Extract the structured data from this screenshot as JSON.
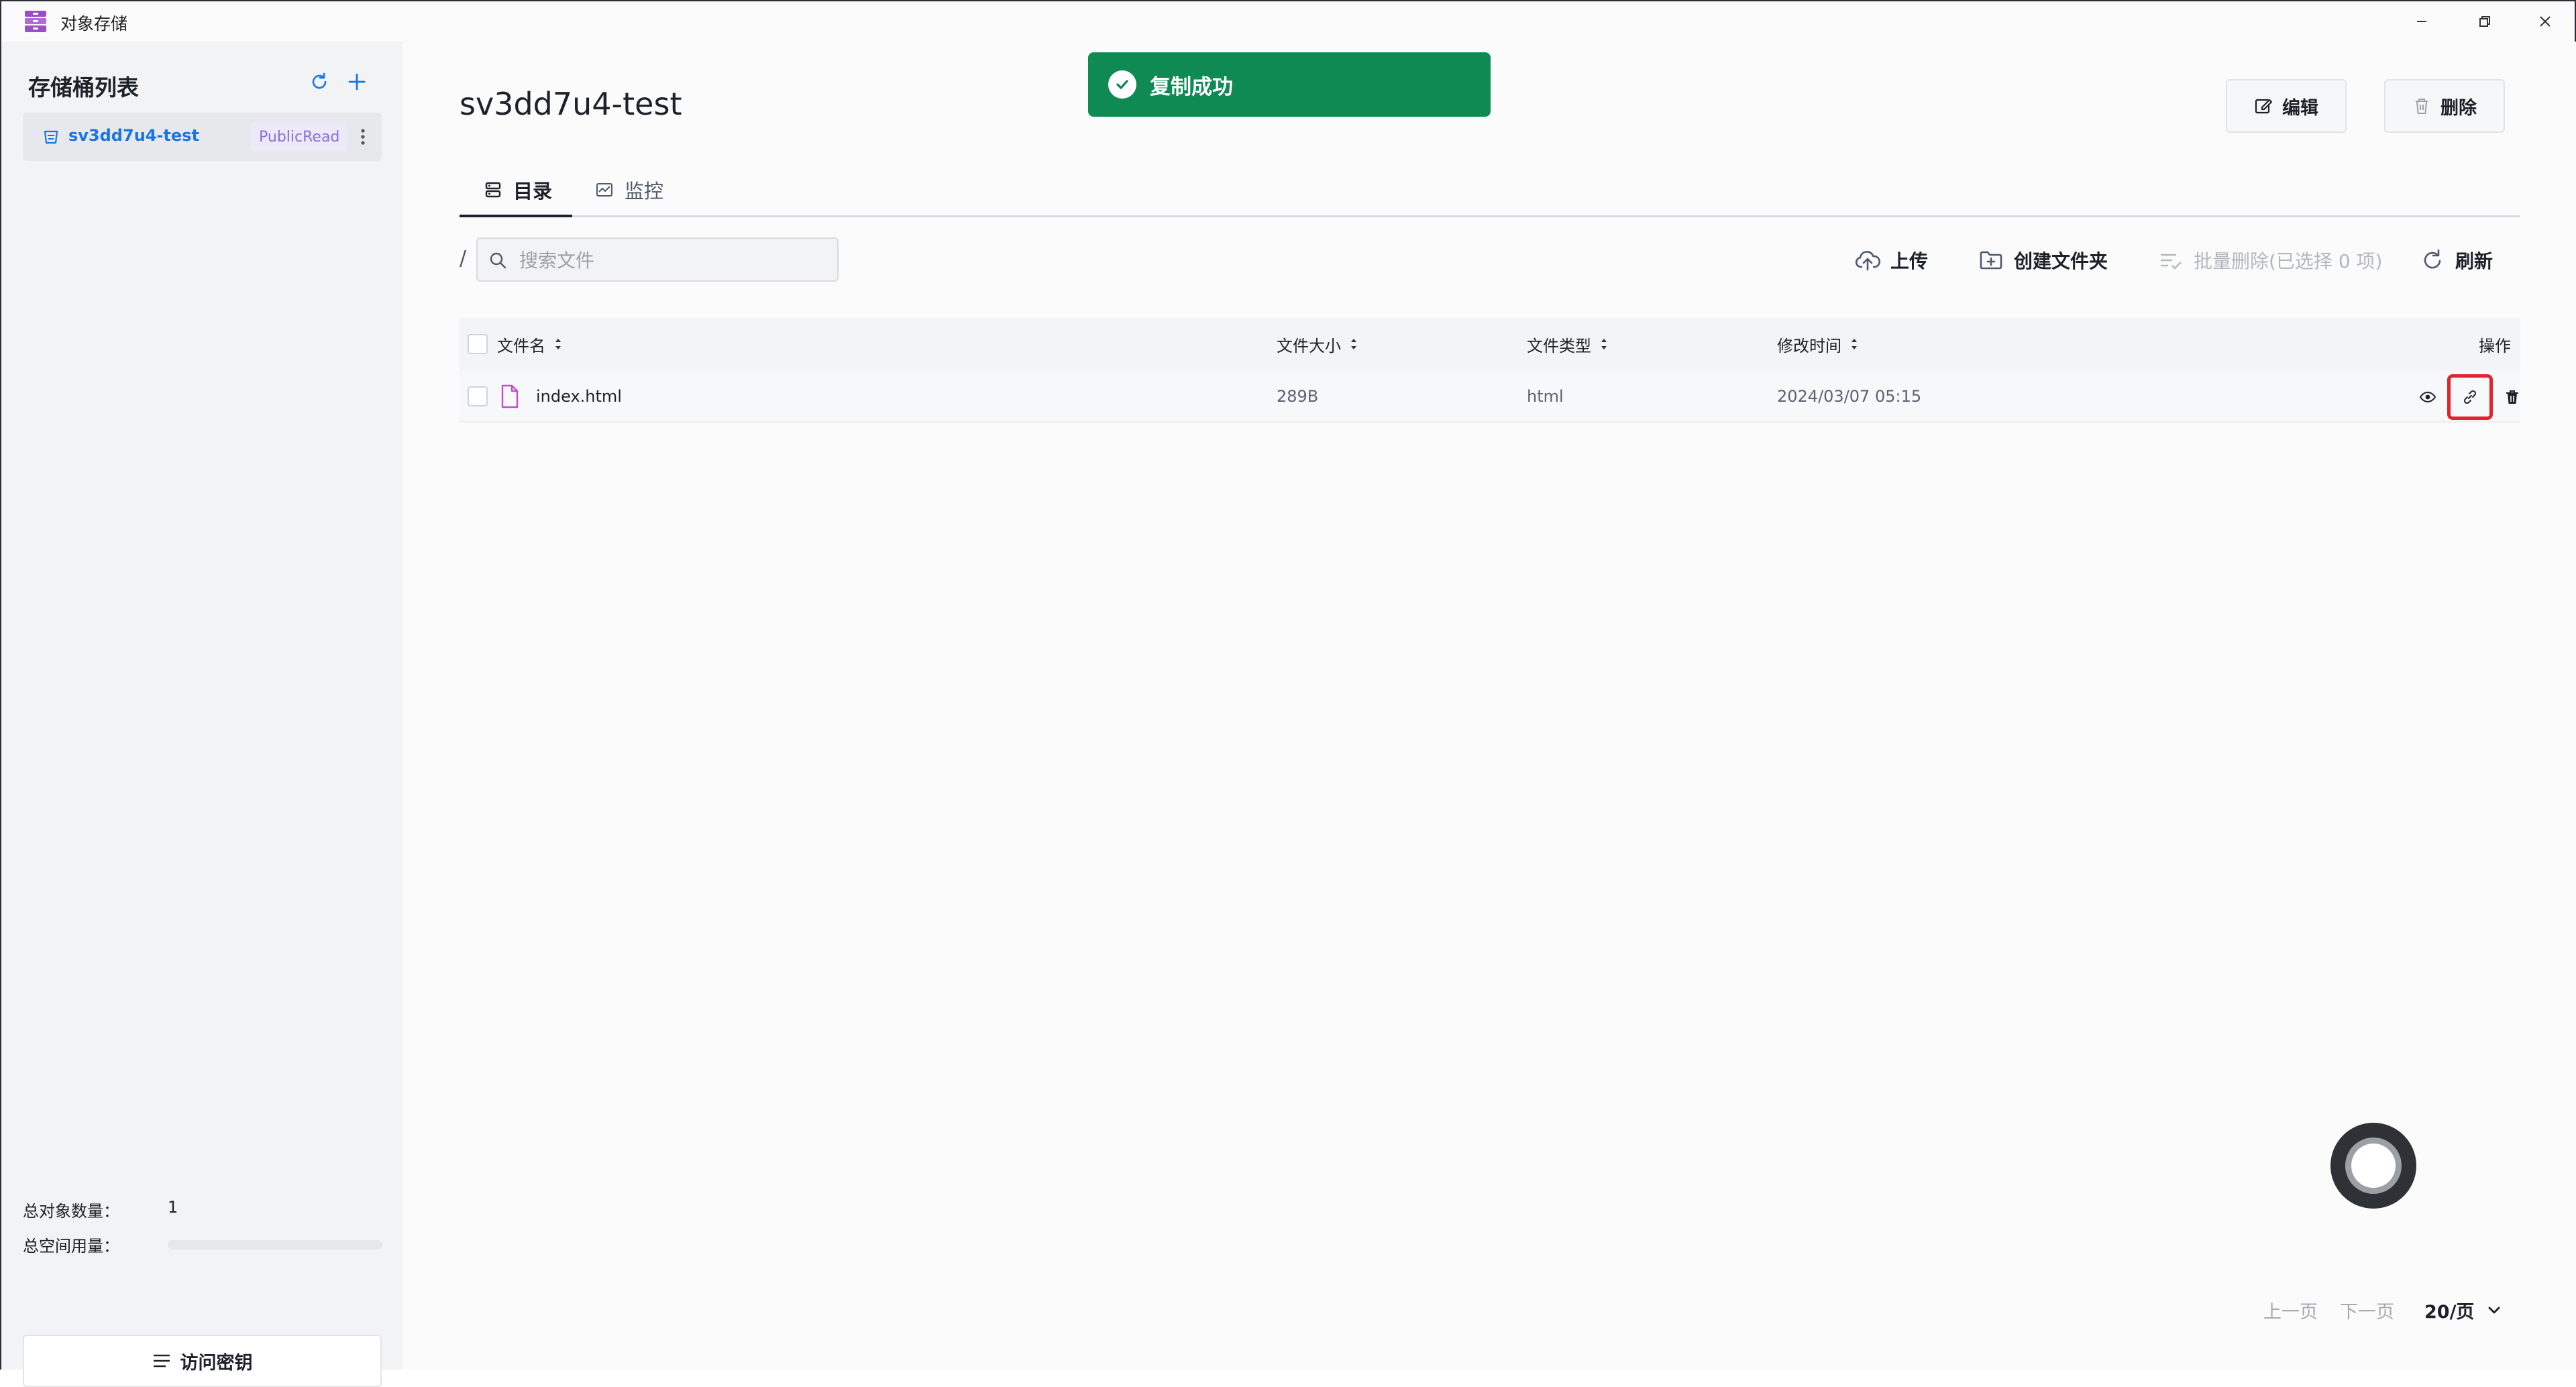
{
  "app": {
    "title": "对象存储"
  },
  "sidebar": {
    "title": "存储桶列表",
    "buckets": [
      {
        "name": "sv3dd7u4-test",
        "badge": "PublicRead"
      }
    ],
    "stats": {
      "object_count_label": "总对象数量：",
      "object_count_value": "1",
      "space_usage_label": "总空间用量：",
      "space_usage_fraction": 0
    },
    "access_key_button": "访问密钥"
  },
  "main": {
    "title": "sv3dd7u4-test",
    "edit_label": "编辑",
    "delete_label": "删除",
    "tabs": [
      {
        "label": "目录",
        "icon": "storage-icon",
        "active": true
      },
      {
        "label": "监控",
        "icon": "monitor-icon",
        "active": false
      }
    ],
    "path": "/",
    "search": {
      "placeholder": "搜索文件",
      "value": ""
    },
    "actions": {
      "upload": "上传",
      "create_folder": "创建文件夹",
      "batch_delete": "批量删除(已选择 0 项)",
      "refresh": "刷新"
    },
    "table": {
      "headers": {
        "name": "文件名",
        "size": "文件大小",
        "type": "文件类型",
        "modified": "修改时间",
        "ops": "操作"
      },
      "rows": [
        {
          "name": "index.html",
          "size": "289B",
          "type": "html",
          "modified": "2024/03/07 05:15"
        }
      ]
    },
    "pagination": {
      "prev": "上一页",
      "next": "下一页",
      "page_size": "20/页"
    }
  },
  "toast": {
    "message": "复制成功",
    "color": "#0f8a52"
  },
  "colors": {
    "accent": "#1a73e8",
    "badge": "#8a6fd6",
    "highlight": "#e0242e"
  }
}
